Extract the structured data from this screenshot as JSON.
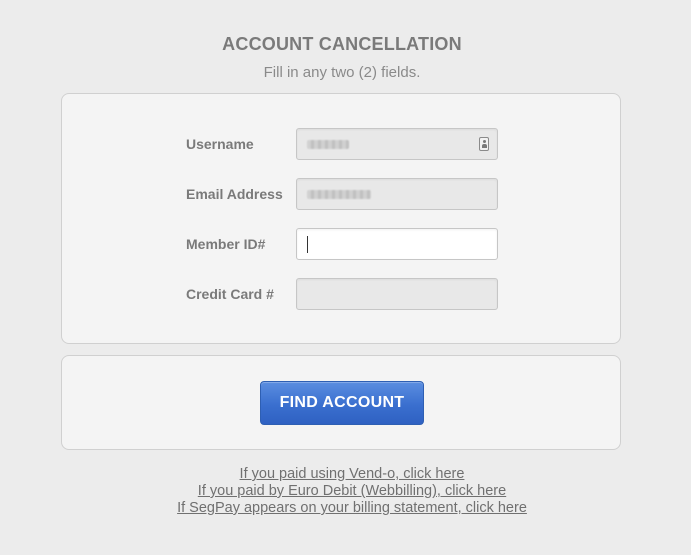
{
  "header": {
    "title": "ACCOUNT CANCELLATION",
    "subtitle": "Fill in any two (2) fields."
  },
  "form": {
    "fields": [
      {
        "label": "Username",
        "value_redacted": true,
        "icon": "contact-card-icon"
      },
      {
        "label": "Email Address",
        "value_redacted": true
      },
      {
        "label": "Member ID#",
        "value": "",
        "focused": true
      },
      {
        "label": "Credit Card #",
        "value": ""
      }
    ]
  },
  "actions": {
    "find_account_label": "FIND ACCOUNT",
    "button_color": "#3a6fcf"
  },
  "links": [
    "If you paid using Vend-o, click here",
    "If you paid by Euro Debit (Webbilling), click here",
    "If SegPay appears on your billing statement, click here"
  ]
}
